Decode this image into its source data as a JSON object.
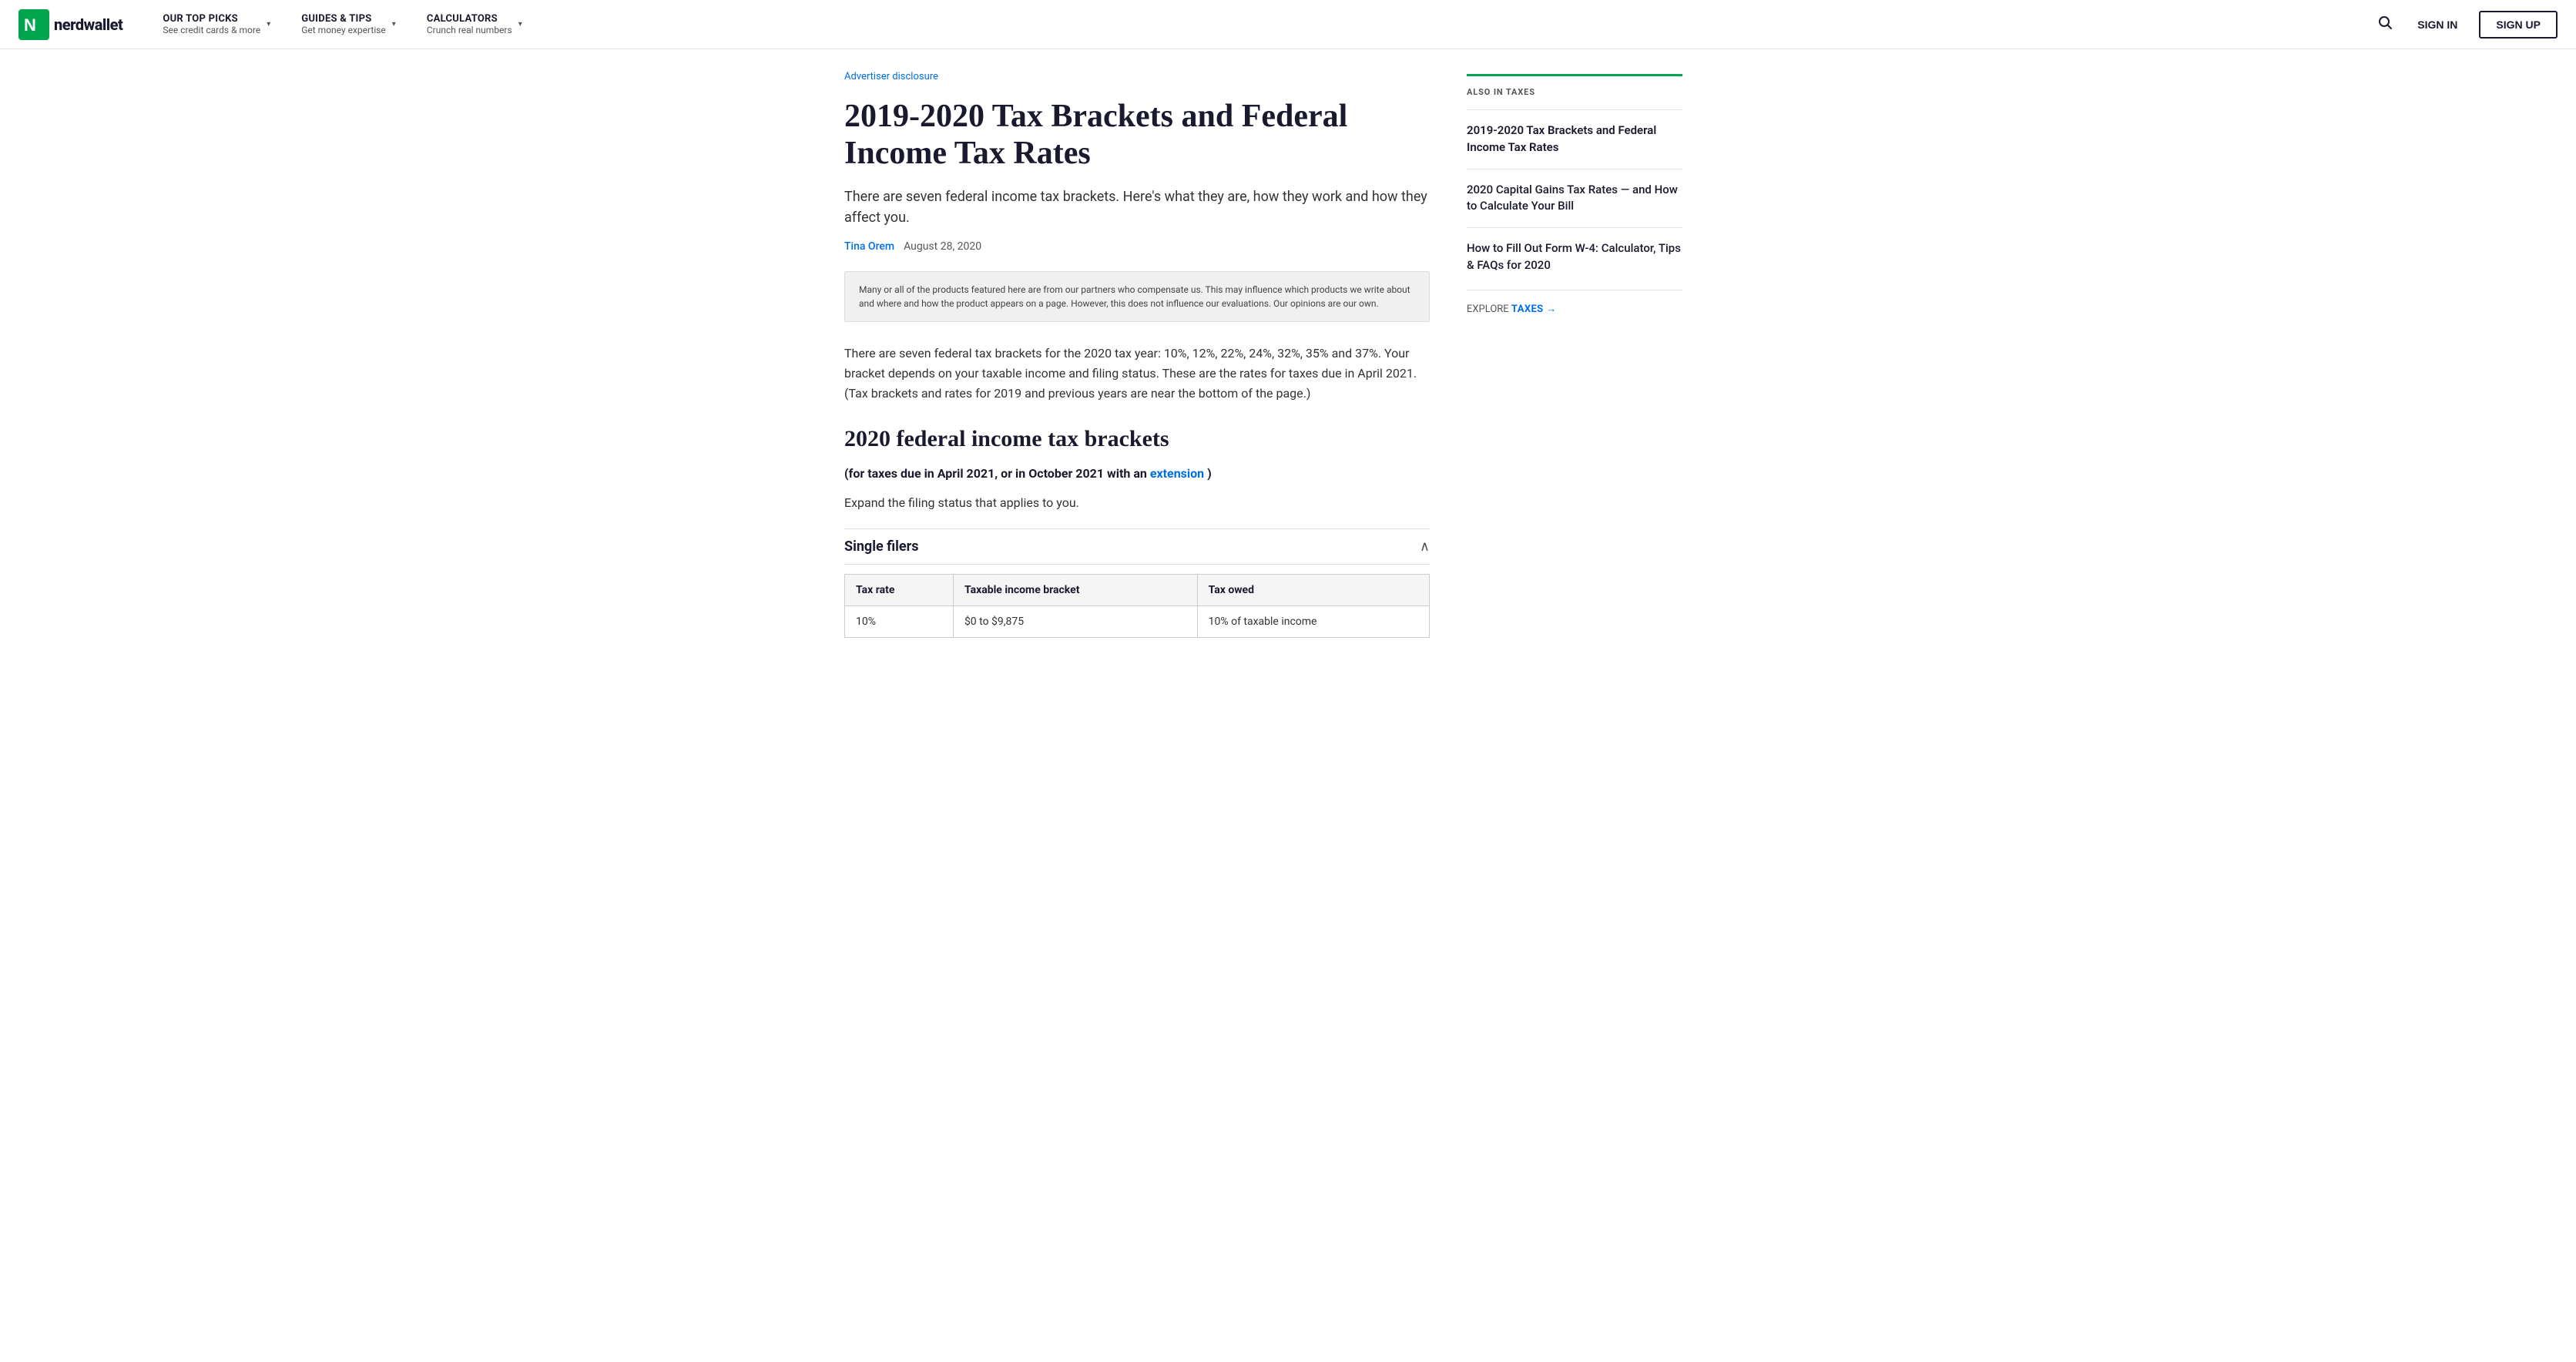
{
  "nav": {
    "logo_alt": "NerdWallet",
    "items": [
      {
        "id": "top-picks",
        "title": "OUR TOP PICKS",
        "subtitle": "See credit cards & more",
        "has_chevron": true
      },
      {
        "id": "guides-tips",
        "title": "GUIDES & TIPS",
        "subtitle": "Get money expertise",
        "has_chevron": true
      },
      {
        "id": "calculators",
        "title": "CALCULATORS",
        "subtitle": "Crunch real numbers",
        "has_chevron": true
      }
    ],
    "search_label": "Search",
    "sign_in_label": "SIGN IN",
    "sign_up_label": "SIGN UP"
  },
  "article": {
    "advertiser_disclosure_text": "Advertiser disclosure",
    "title": "2019-2020 Tax Brackets and Federal Income Tax Rates",
    "subtitle": "There are seven federal income tax brackets. Here's what they are, how they work and how they affect you.",
    "author_name": "Tina Orem",
    "publish_date": "August 28, 2020",
    "disclosure_text": "Many or all of the products featured here are from our partners who compensate us. This may influence which products we write about and where and how the product appears on a page. However, this does not influence our evaluations. Our opinions are our own.",
    "body_text": "There are seven federal tax brackets for the 2020 tax year: 10%, 12%, 22%, 24%, 32%, 35% and 37%. Your bracket depends on your taxable income and filing status. These are the rates for taxes due in April 2021. (Tax brackets and rates for 2019 and previous years are near the bottom of the page.)",
    "section_heading": "2020 federal income tax brackets",
    "subheading": "(for taxes due in April 2021, or in October 2021 with an",
    "extension_link_text": "extension",
    "subheading_end": ")",
    "expand_text": "Expand the filing status that applies to you.",
    "filers_label": "Single filers",
    "table": {
      "headers": [
        "Tax rate",
        "Taxable income bracket",
        "Tax owed"
      ],
      "rows": [
        [
          "10%",
          "$0 to $9,875",
          "10% of taxable income"
        ]
      ]
    }
  },
  "sidebar": {
    "section_title": "ALSO IN TAXES",
    "links": [
      {
        "id": "current-article",
        "text": "2019-2020 Tax Brackets and Federal Income Tax Rates",
        "active": true
      },
      {
        "id": "capital-gains",
        "text": "2020 Capital Gains Tax Rates — and How to Calculate Your Bill",
        "active": false
      },
      {
        "id": "w4-form",
        "text": "How to Fill Out Form W-4: Calculator, Tips & FAQs for 2020",
        "active": false
      }
    ],
    "explore_prefix": "EXPLORE",
    "explore_link_text": "TAXES",
    "explore_arrow": "→"
  }
}
